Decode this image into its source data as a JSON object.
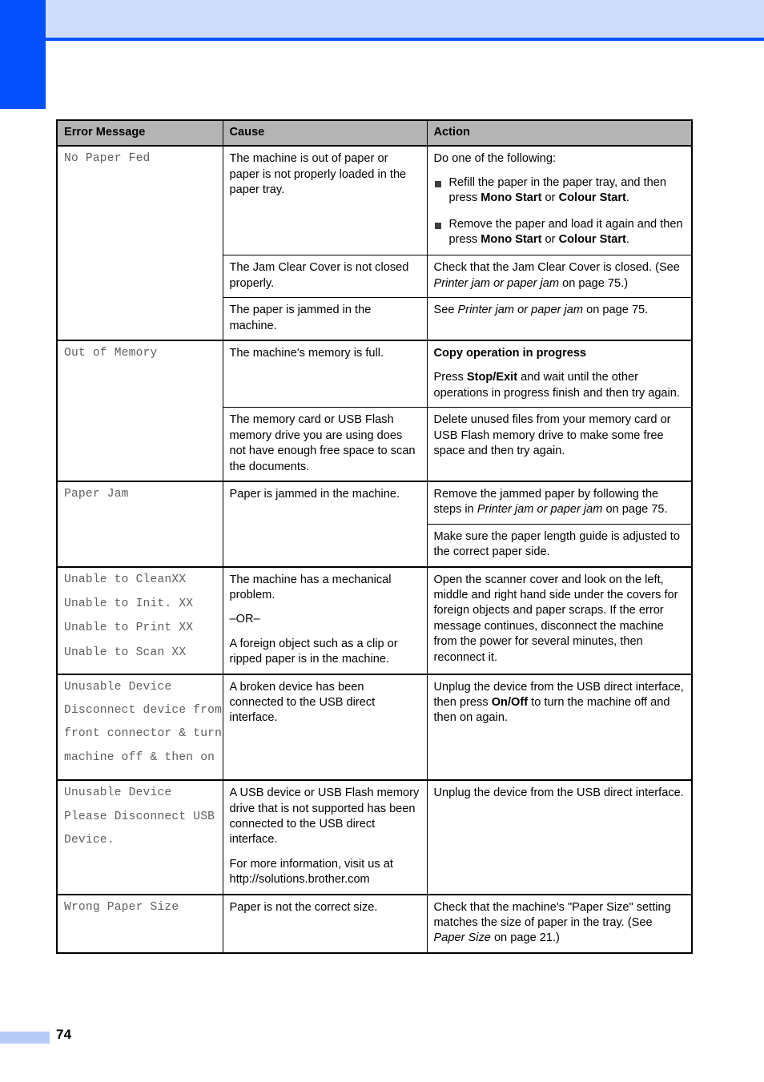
{
  "page": {
    "number": "74",
    "accent_color": "#0450fd",
    "header_band_color": "#cfdcfb",
    "footer_tab_color": "#b6cbf8",
    "table_header_color": "#b4b4b4"
  },
  "table": {
    "headers": {
      "error_message": "Error Message",
      "cause": "Cause",
      "action": "Action"
    },
    "rows": [
      {
        "message_lines": [
          "No Paper Fed"
        ],
        "cause": "The machine is out of paper or paper is not properly loaded in the paper tray.",
        "action_intro": "Do one of the following:",
        "action_bullets": [
          {
            "pre": "Refill the paper in the paper tray, and then press ",
            "b1": "Mono Start",
            "mid": " or ",
            "b2": "Colour Start",
            "post": "."
          },
          {
            "pre": "Remove the paper and load it again and then press ",
            "b1": "Mono Start",
            "mid": " or ",
            "b2": "Colour Start",
            "post": "."
          }
        ]
      },
      {
        "cause": "The Jam Clear Cover is not closed properly.",
        "action_pre": "Check that the Jam Clear Cover is closed. (See ",
        "action_italic": "Printer jam or paper jam",
        "action_post": " on page 75.)"
      },
      {
        "cause": "The paper is jammed in the machine.",
        "action_pre": "See ",
        "action_italic": "Printer jam or paper jam",
        "action_post": " on page 75."
      },
      {
        "message_lines": [
          "Out of Memory"
        ],
        "cause": "The machine's memory is full.",
        "action_heading": "Copy operation in progress",
        "action_pre": "Press ",
        "action_bold": "Stop/Exit",
        "action_post": " and wait until the other operations in progress finish and then try again."
      },
      {
        "cause": "The memory card or USB Flash memory drive you are using does not have enough free space to scan the documents.",
        "action": "Delete unused files from your memory card or USB Flash memory drive to make some free space and then try again."
      },
      {
        "message_lines": [
          "Paper Jam"
        ],
        "cause": "Paper is jammed in the machine.",
        "action_pre": "Remove the jammed paper by following the steps in ",
        "action_italic": "Printer jam or paper jam",
        "action_post": " on page 75."
      },
      {
        "action": "Make sure the paper length guide is adjusted to the correct paper side."
      },
      {
        "message_lines": [
          "Unable to CleanXX",
          "Unable to Init. XX",
          "Unable to Print XX",
          "Unable to Scan XX"
        ],
        "cause_p1": "The machine has a mechanical problem.",
        "cause_p2": "–OR–",
        "cause_p3": "A foreign object such as a clip or ripped paper is in the machine.",
        "action": "Open the scanner cover and look on the left, middle and right hand side under the covers for foreign objects and paper scraps. If the error message continues, disconnect the machine from the power for several minutes, then reconnect it."
      },
      {
        "message_lines": [
          "Unusable Device",
          "Disconnect device from",
          "front connector & turn",
          "machine off & then on"
        ],
        "cause": "A broken device has been connected to the USB direct interface.",
        "action_pre": "Unplug the device from the USB direct interface, then press ",
        "action_bold": "On/Off",
        "action_post": " to turn the machine off and then on again."
      },
      {
        "message_lines": [
          "Unusable Device",
          "Please Disconnect USB",
          "Device."
        ],
        "cause_p1": "A USB device or USB Flash memory drive that is not supported has been connected to the USB direct interface.",
        "cause_p2": "For more information, visit us at http://solutions.brother.com",
        "action": "Unplug the device from the USB direct interface."
      },
      {
        "message_lines": [
          "Wrong Paper Size"
        ],
        "cause": "Paper is not the correct size.",
        "action_pre": "Check that the machine's \"Paper Size\" setting matches the size of paper in the tray. (See ",
        "action_italic": "Paper Size",
        "action_post": " on page 21.)"
      }
    ]
  }
}
